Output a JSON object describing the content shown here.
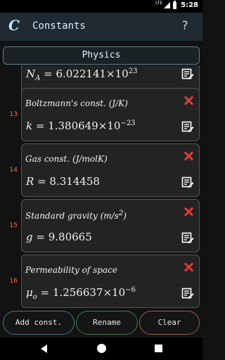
{
  "status_bar": {
    "network": "LTE",
    "time": "5:28"
  },
  "app_bar": {
    "logo": "C",
    "title": "Constants",
    "help": "?"
  },
  "category": {
    "label": "Physics"
  },
  "partial_row": {
    "symbol": "N",
    "sub": "A",
    "eq": " = 6.022141×10",
    "exp": "23"
  },
  "constants": [
    {
      "index": "13",
      "name": "Boltzmann's const. (J/K)",
      "symbol": "k",
      "sub": "",
      "eq": " = 1.380649×10",
      "exp": "−23"
    },
    {
      "index": "14",
      "name": "Gas const. (J/molK)",
      "symbol": "R",
      "sub": "",
      "eq": " = 8.314458",
      "exp": ""
    },
    {
      "index": "15",
      "name": "Standard gravity (m/s",
      "name_sup": "2",
      "name_tail": ")",
      "symbol": "g",
      "sub": "",
      "eq": " = 9.80665",
      "exp": ""
    },
    {
      "index": "16",
      "name": "Permeability of space",
      "symbol": "μ",
      "sub": "o",
      "eq": " = 1.256637×10",
      "exp": "−6"
    }
  ],
  "buttons": {
    "add": "Add const.",
    "rename": "Rename",
    "clear": "Clear"
  },
  "colors": {
    "delete": "#e53935",
    "index": "#ff6c4a",
    "app_bar": "#1f2a33"
  }
}
